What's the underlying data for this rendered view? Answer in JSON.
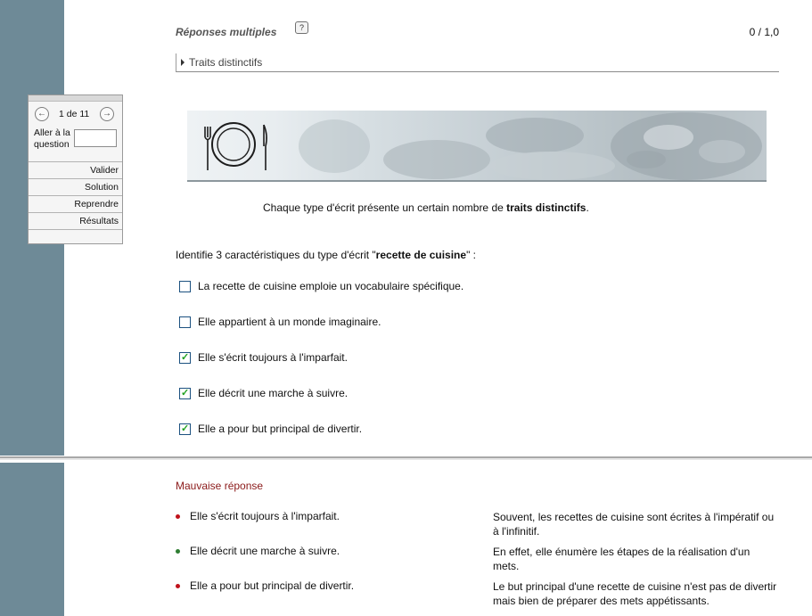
{
  "nav": {
    "counter": "1 de 11",
    "goto_label": "Aller à la question",
    "buttons": [
      {
        "label": "Valider"
      },
      {
        "label": "Solution"
      },
      {
        "label": "Reprendre"
      },
      {
        "label": "Résultats"
      }
    ]
  },
  "header": {
    "title": "Réponses multiples",
    "help": "?",
    "score": "0 / 1,0"
  },
  "section": {
    "label": "Traits distinctifs"
  },
  "intro": {
    "before": "Chaque type d'écrit présente un certain nombre de ",
    "bold": "traits distinctifs",
    "after": "."
  },
  "question": {
    "before": "Identifie 3 caractéristiques du type d'écrit \"",
    "bold": "recette de cuisine",
    "after": "\" :"
  },
  "options": [
    {
      "label": "La recette de cuisine emploie un vocabulaire spécifique.",
      "checked": false
    },
    {
      "label": "Elle appartient à un monde imaginaire.",
      "checked": false
    },
    {
      "label": "Elle s'écrit toujours à l'imparfait.",
      "checked": true
    },
    {
      "label": "Elle décrit une marche à suivre.",
      "checked": true
    },
    {
      "label": "Elle a pour but principal de divertir.",
      "checked": true
    }
  ],
  "feedback": {
    "title": "Mauvaise réponse",
    "items": [
      {
        "answer": "Elle s'écrit toujours à l'imparfait.",
        "explanation": "Souvent, les recettes de cuisine sont écrites à l'impératif ou à l'infinitif.",
        "correct": false
      },
      {
        "answer": "Elle décrit une marche à suivre.",
        "explanation": "En effet, elle énumère les étapes de la réalisation d'un mets.",
        "correct": true
      },
      {
        "answer": "Elle a pour but principal de divertir.",
        "explanation": "Le but principal d'une recette de cuisine n'est pas de divertir mais bien de préparer des mets appétissants.",
        "correct": false
      }
    ]
  },
  "colors": {
    "side_strip": "#6e8a97",
    "feedback_title": "#8b1a1a",
    "bullet_wrong": "#c0121b",
    "bullet_right": "#2e7d32",
    "check": "#21a121"
  },
  "icons": {
    "prev": "arrow-left-circle-icon",
    "next": "arrow-right-circle-icon",
    "help": "question-icon",
    "section": "triangle-right-icon",
    "banner": "plate-fork-knife-icon"
  }
}
